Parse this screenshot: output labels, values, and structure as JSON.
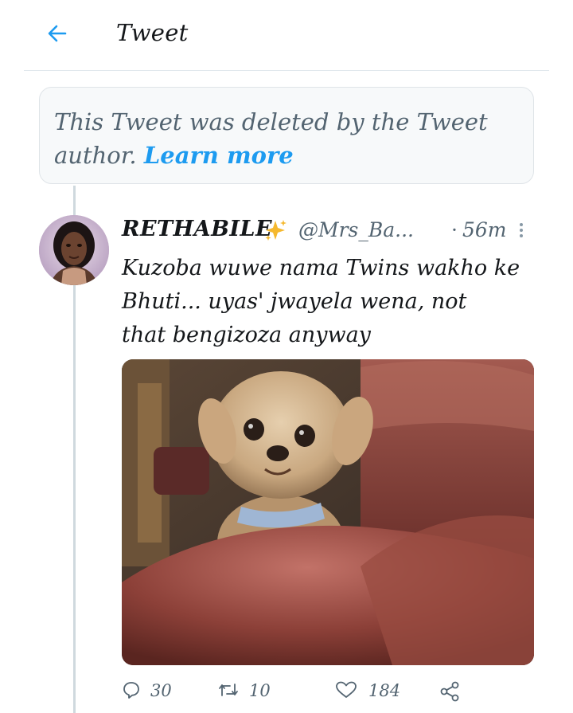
{
  "header": {
    "title": "Tweet",
    "back_icon": "back-arrow-icon",
    "accent_color": "#1d9bf0"
  },
  "notice": {
    "text": "This Tweet was deleted by the Tweet author.",
    "link": "Learn more"
  },
  "tweet": {
    "display_name": "RETHABILE",
    "badge_icon": "sparkles-icon",
    "handle": "@Mrs_Ba...",
    "separator": "·",
    "time": "56m",
    "text": "Kuzoba wuwe nama Twins wakho ke\nBhuti... uyas' jwayela wena, not\nthat bengizoza anyway",
    "media_icon": "photo-dog-on-couch"
  },
  "actions": {
    "reply_count": "30",
    "retweet_count": "10",
    "like_count": "184",
    "reply_icon": "reply-icon",
    "retweet_icon": "retweet-icon",
    "like_icon": "heart-icon",
    "share_icon": "share-icon"
  }
}
